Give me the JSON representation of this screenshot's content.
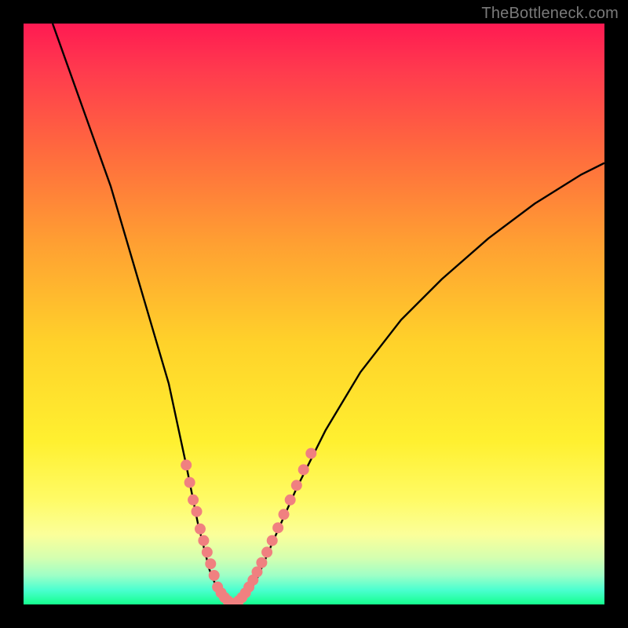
{
  "watermark": "TheBottleneck.com",
  "chart_data": {
    "type": "line",
    "title": "",
    "xlabel": "",
    "ylabel": "",
    "xlim": [
      0,
      100
    ],
    "ylim": [
      0,
      100
    ],
    "grid": false,
    "legend": false,
    "curve": [
      {
        "x": 5,
        "y": 100
      },
      {
        "x": 10,
        "y": 86
      },
      {
        "x": 15,
        "y": 72
      },
      {
        "x": 20,
        "y": 55
      },
      {
        "x": 25,
        "y": 38
      },
      {
        "x": 28,
        "y": 24
      },
      {
        "x": 30,
        "y": 14
      },
      {
        "x": 32,
        "y": 6
      },
      {
        "x": 34,
        "y": 1
      },
      {
        "x": 36,
        "y": 0
      },
      {
        "x": 38,
        "y": 1
      },
      {
        "x": 40,
        "y": 4
      },
      {
        "x": 43,
        "y": 11
      },
      {
        "x": 47,
        "y": 20
      },
      {
        "x": 52,
        "y": 30
      },
      {
        "x": 58,
        "y": 40
      },
      {
        "x": 65,
        "y": 49
      },
      {
        "x": 72,
        "y": 56
      },
      {
        "x": 80,
        "y": 63
      },
      {
        "x": 88,
        "y": 69
      },
      {
        "x": 96,
        "y": 74
      },
      {
        "x": 100,
        "y": 76
      }
    ],
    "points_left": [
      {
        "x": 28.0,
        "y": 24
      },
      {
        "x": 28.6,
        "y": 21
      },
      {
        "x": 29.2,
        "y": 18
      },
      {
        "x": 29.8,
        "y": 16
      },
      {
        "x": 30.4,
        "y": 13
      },
      {
        "x": 31.0,
        "y": 11
      },
      {
        "x": 31.6,
        "y": 9
      },
      {
        "x": 32.2,
        "y": 7
      },
      {
        "x": 32.8,
        "y": 5
      },
      {
        "x": 33.4,
        "y": 3
      },
      {
        "x": 34.0,
        "y": 2
      },
      {
        "x": 34.6,
        "y": 1.2
      },
      {
        "x": 35.2,
        "y": 0.6
      },
      {
        "x": 35.8,
        "y": 0.2
      }
    ],
    "points_right": [
      {
        "x": 36.4,
        "y": 0.2
      },
      {
        "x": 37.0,
        "y": 0.6
      },
      {
        "x": 37.6,
        "y": 1.2
      },
      {
        "x": 38.2,
        "y": 2.0
      },
      {
        "x": 38.8,
        "y": 3.0
      },
      {
        "x": 39.5,
        "y": 4.2
      },
      {
        "x": 40.2,
        "y": 5.6
      },
      {
        "x": 41.0,
        "y": 7.2
      },
      {
        "x": 41.9,
        "y": 9.0
      },
      {
        "x": 42.8,
        "y": 11.0
      },
      {
        "x": 43.8,
        "y": 13.2
      },
      {
        "x": 44.8,
        "y": 15.5
      },
      {
        "x": 45.9,
        "y": 18.0
      },
      {
        "x": 47.0,
        "y": 20.5
      },
      {
        "x": 48.2,
        "y": 23.2
      },
      {
        "x": 49.5,
        "y": 26.0
      }
    ],
    "colors": {
      "curve": "#000000",
      "points": "#f08080"
    },
    "point_radius": 7
  }
}
